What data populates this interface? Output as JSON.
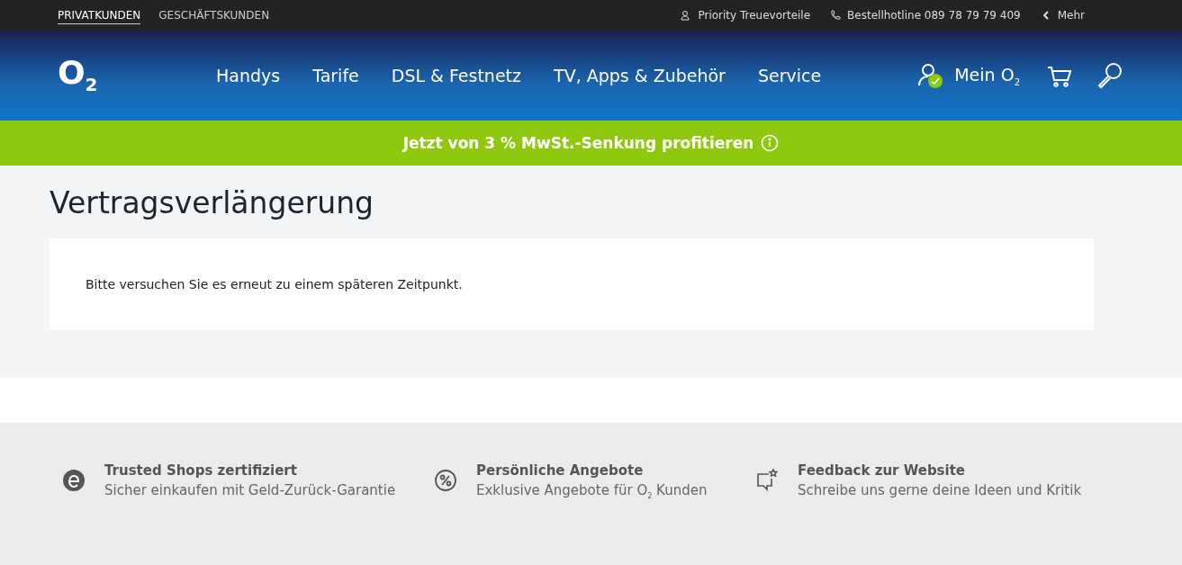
{
  "top_bar": {
    "segments": [
      {
        "label": "PRIVATKUNDEN",
        "selected": true
      },
      {
        "label": "GESCHÄFTSKUNDEN",
        "selected": false
      }
    ],
    "links": [
      {
        "kind": "priority",
        "label": "Priority Treuevorteile"
      },
      {
        "kind": "phone",
        "label": "Bestellhotline 089 78 79 79 409"
      },
      {
        "kind": "more",
        "label": "Mehr"
      }
    ]
  },
  "header": {
    "logo": "O$_{2}$",
    "nav": [
      "Handys",
      "Tarife",
      "DSL & Festnetz",
      "TV, Apps & Zubehör",
      "Service"
    ],
    "account": "Mein O$_{2}$"
  },
  "banner": {
    "text": "Jetzt von 3 % MwSt.-Senkung profitieren"
  },
  "page": {
    "title": "Vertragsverlängerung",
    "message": "Bitte versuchen Sie es erneut zu einem späteren Zeitpunkt."
  },
  "footer": [
    {
      "kind": "trusted",
      "title": "Trusted Shops zertifiziert",
      "subtitle": "Sicher einkaufen mit Geld-Zurück-Garantie"
    },
    {
      "kind": "percent",
      "title": "Persönliche Angebote",
      "subtitle": "Exklusive Angebote für O$_{2}$ Kunden"
    },
    {
      "kind": "feedback",
      "title": "Feedback zur Website",
      "subtitle": "Schreibe uns gerne deine Ideen und Kritik"
    }
  ]
}
